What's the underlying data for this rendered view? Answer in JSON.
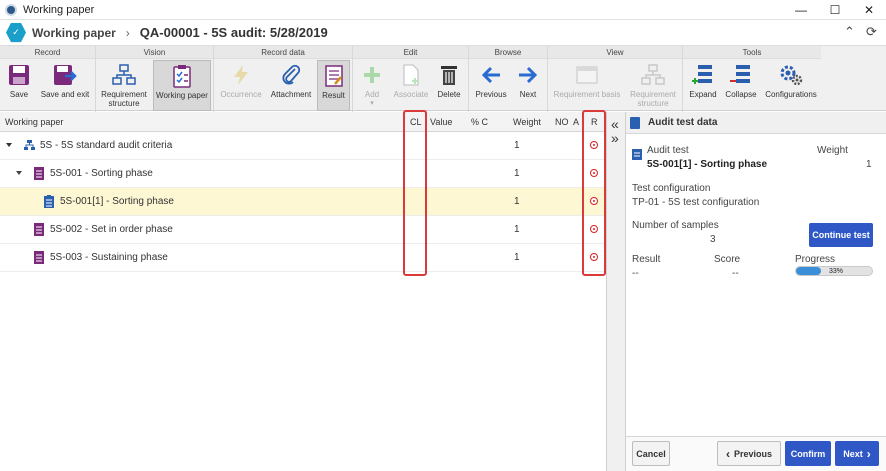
{
  "window": {
    "title": "Working paper",
    "minimize": "—",
    "maximize": "☐",
    "close": "✕"
  },
  "header": {
    "breadcrumb_root": "Working paper",
    "breadcrumb_sep": "›",
    "title": "QA-00001 - 5S audit: 5/28/2019"
  },
  "ribbon": {
    "groups": {
      "record": "Record",
      "vision": "Vision",
      "record_data": "Record data",
      "edit": "Edit",
      "browse": "Browse",
      "view": "View",
      "tools": "Tools"
    },
    "buttons": {
      "save": "Save",
      "save_exit": "Save and exit",
      "req_structure": "Requirement structure",
      "working_paper": "Working paper",
      "occurrence": "Occurrence",
      "attachment": "Attachment",
      "result": "Result",
      "add": "Add",
      "associate": "Associate",
      "delete": "Delete",
      "previous": "Previous",
      "next": "Next",
      "req_basis": "Requirement basis",
      "req_structure2": "Requirement structure",
      "expand": "Expand",
      "collapse": "Collapse",
      "configurations": "Configurations"
    }
  },
  "grid": {
    "columns": {
      "name": "Working paper",
      "cl": "CL",
      "value": "Value",
      "pct_c": "% C",
      "weight": "Weight",
      "no": "NO",
      "a": "A",
      "r": "R"
    },
    "rows": [
      {
        "label": "5S - 5S standard audit criteria",
        "weight": "1"
      },
      {
        "label": "5S-001 - Sorting phase",
        "weight": "1"
      },
      {
        "label": "5S-001[1] - Sorting phase",
        "weight": "1"
      },
      {
        "label": "5S-002 - Set in order phase",
        "weight": "1"
      },
      {
        "label": "5S-003 - Sustaining phase",
        "weight": "1"
      }
    ]
  },
  "panel": {
    "title": "Audit test data",
    "audit_test_label": "Audit test",
    "audit_test_value": "5S-001[1] - Sorting phase",
    "weight_label": "Weight",
    "weight_value": "1",
    "test_config_label": "Test configuration",
    "test_config_value": "TP-01 - 5S test configuration",
    "samples_label": "Number of samples",
    "samples_value": "3",
    "continue_test": "Continue test",
    "result_label": "Result",
    "result_value": "--",
    "score_label": "Score",
    "score_value": "--",
    "progress_label": "Progress",
    "progress_percent": 33,
    "progress_text": "33%"
  },
  "footer": {
    "cancel": "Cancel",
    "previous": "Previous",
    "confirm": "Confirm",
    "next": "Next"
  },
  "colors": {
    "accent_blue": "#2f57c6",
    "highlight_red": "#d93a3a",
    "selected_row": "#fdf8d3"
  }
}
